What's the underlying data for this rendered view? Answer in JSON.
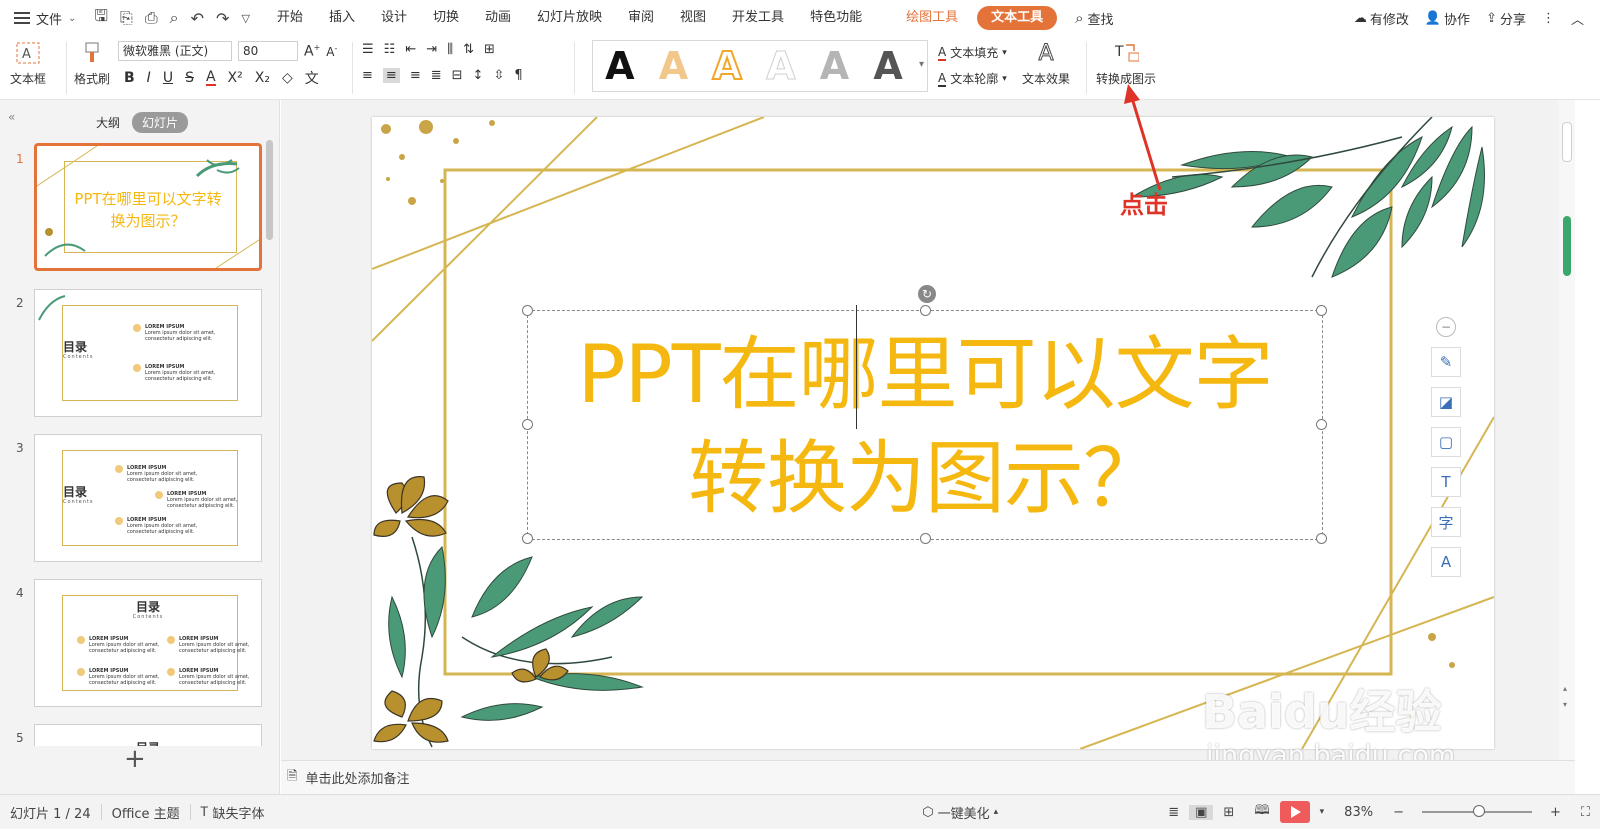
{
  "menubar": {
    "file_label": "文件",
    "tabs": [
      "开始",
      "插入",
      "设计",
      "切换",
      "动画",
      "幻灯片放映",
      "审阅",
      "视图",
      "开发工具",
      "特色功能"
    ],
    "context_tab": "绘图工具",
    "active_tab": "文本工具",
    "search_label": "查找",
    "right": {
      "changes": "有修改",
      "collab": "协作",
      "share": "分享"
    }
  },
  "ribbon": {
    "textbox_label": "文本框",
    "format_painter_label": "格式刷",
    "font_name": "微软雅黑 (正文)",
    "font_size": "80",
    "text_fill_label": "文本填充",
    "text_outline_label": "文本轮廓",
    "text_effect_label": "文本效果",
    "convert_label": "转换成图示",
    "style_glyph": "A"
  },
  "leftpane": {
    "tab_outline": "大纲",
    "tab_slides": "幻灯片",
    "slides": [
      {
        "num": "1",
        "title": "PPT在哪里可以文字转换为图示？"
      },
      {
        "num": "2",
        "dir": "目录",
        "sub": "Contents",
        "item_title": "LOREM IPSUM",
        "item_text": "Lorem ipsum dolor sit amet, consectetur adipiscing elit."
      },
      {
        "num": "3",
        "dir": "目录",
        "sub": "Contents",
        "item_title": "LOREM IPSUM",
        "item_text": "Lorem ipsum dolor sit amet, consectetur adipiscing elit."
      },
      {
        "num": "4",
        "dir": "目录",
        "sub": "Contents",
        "item_title": "LOREM IPSUM",
        "item_text": "Lorem ipsum dolor sit amet, consectetur adipiscing elit."
      },
      {
        "num": "5",
        "dir": "目录"
      }
    ],
    "add_label": "+"
  },
  "slide": {
    "title_line1": "PPT在哪里可以文字",
    "title_line2": "转换为图示？"
  },
  "annotation": "点击",
  "notes_placeholder": "单击此处添加备注",
  "status": {
    "slide_count": "幻灯片 1 / 24",
    "theme": "Office 主题",
    "missing_font": "缺失字体",
    "beautify": "一键美化",
    "zoom": "83%"
  },
  "watermark": {
    "brand": "Baidu经验",
    "url": "jingyan.baidu.com"
  },
  "colors": {
    "accent": "#e4733a",
    "title": "#f5b810",
    "gold_line": "#d6b652",
    "leaf": "#4a9a78",
    "flower": "#b8902e",
    "annotation": "#e03328"
  },
  "icons": [
    "hamburger-icon",
    "save-icon",
    "undo-icon",
    "redo-icon",
    "print-icon",
    "search-icon",
    "cloud-icon",
    "collab-icon",
    "share-icon",
    "textbox-icon",
    "brush-icon",
    "bold-icon",
    "italic-icon",
    "underline-icon",
    "strike-icon",
    "font-color-icon",
    "superscript-icon",
    "subscript-icon",
    "eraser-icon",
    "bullet-list-icon",
    "numbered-list-icon",
    "align-left-icon",
    "align-center-icon",
    "align-right-icon",
    "justify-icon",
    "line-spacing-icon",
    "text-fill-icon",
    "text-outline-icon",
    "text-effect-icon",
    "convert-smartart-icon",
    "rotate-icon",
    "pen-icon",
    "fill-icon",
    "border-icon",
    "note-icon",
    "play-icon"
  ]
}
